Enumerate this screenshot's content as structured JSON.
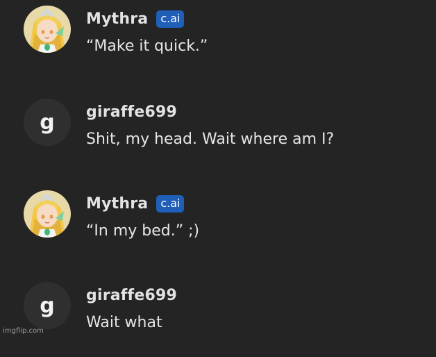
{
  "messages": [
    {
      "author": "Mythra",
      "badge": "c.ai",
      "text": "“Make it quick.”",
      "avatar": "character-portrait"
    },
    {
      "author": "giraffe699",
      "avatar_letter": "g",
      "text": "Shit, my head. Wait where am I?"
    },
    {
      "author": "Mythra",
      "badge": "c.ai",
      "text": "“In my bed.” ;)",
      "avatar": "character-portrait"
    },
    {
      "author": "giraffe699",
      "avatar_letter": "g",
      "text": "Wait what"
    }
  ],
  "watermark": "imgflip.com",
  "colors": {
    "background": "#242424",
    "badge": "#1f5fb7",
    "text": "#e6e6e6",
    "avatar_bg": "#2f2f2f"
  }
}
